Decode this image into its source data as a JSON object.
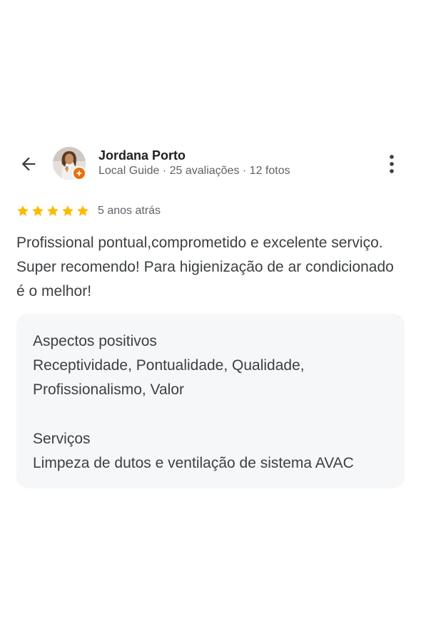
{
  "header": {
    "author_name": "Jordana Porto",
    "author_meta": "Local Guide · 25 avaliações · 12 fotos"
  },
  "icons": {
    "back": "arrow-left-icon",
    "more": "more-vert-icon",
    "badge": "local-guide-badge-icon",
    "star": "star-icon"
  },
  "review": {
    "rating": 5,
    "max_rating": 5,
    "time_ago": "5 anos atrás",
    "text": "Profissional pontual,comprometido e excelente serviço. Super recomendo! Para higienização de ar condicionado é o melhor!"
  },
  "attributes": {
    "positive_title": "Aspectos positivos",
    "positive_value": "Receptividade, Pontualidade, Qualidade, Profissionalismo, Valor",
    "services_title": "Serviços",
    "services_value": "Limpeza de dutos e ventilação de sistema AVAC"
  },
  "colors": {
    "star": "#fbbc04",
    "badge": "#e8710a",
    "card_bg": "#f6f7f9",
    "secondary_text": "#5f6368"
  }
}
